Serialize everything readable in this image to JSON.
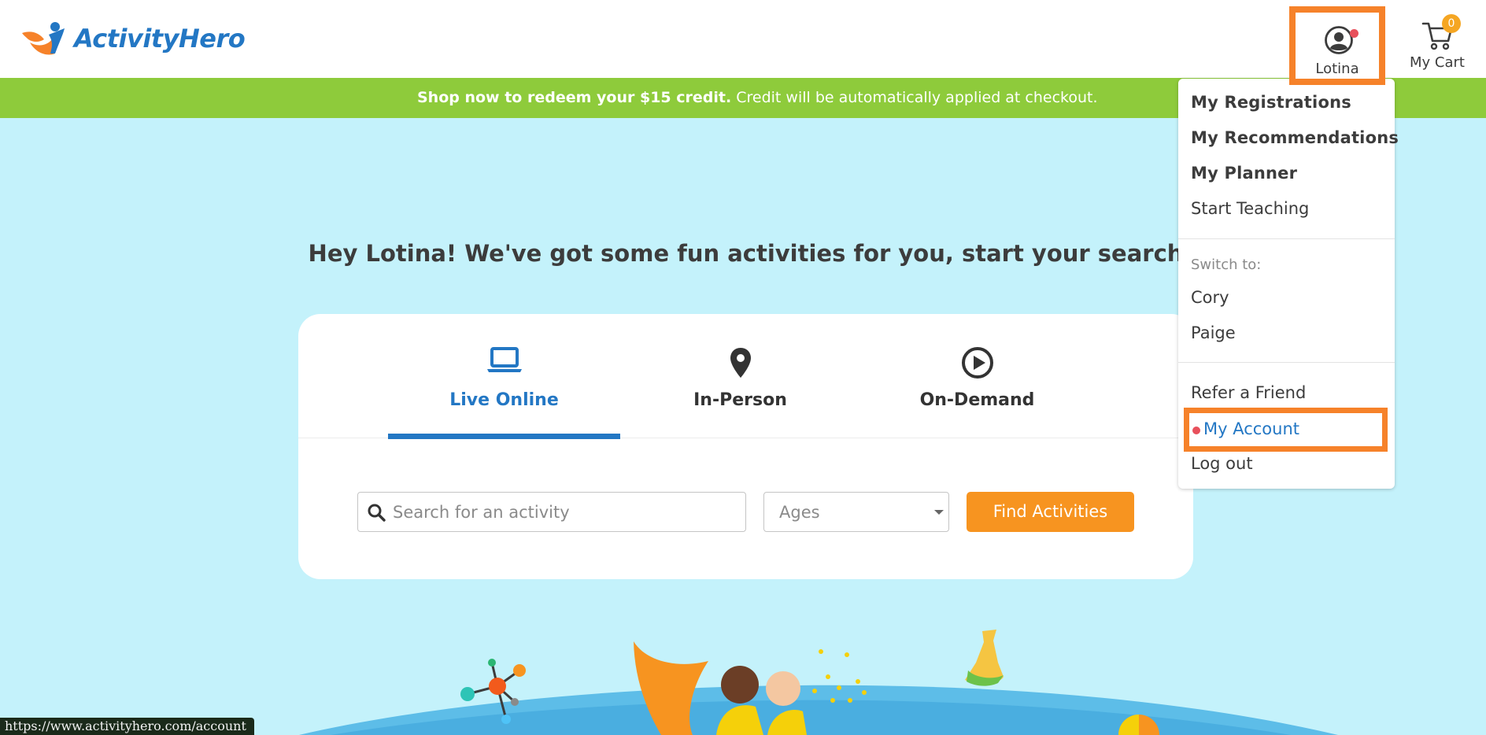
{
  "header": {
    "logo_text": "ActivityHero",
    "user_name": "Lotina",
    "cart_label": "My Cart",
    "cart_count": "0"
  },
  "banner": {
    "strong_text": "Shop now to redeem your $15 credit.",
    "text": " Credit will be automatically applied at checkout."
  },
  "hero": {
    "title": "Hey Lotina! We've got some fun activities for you, start your search"
  },
  "search": {
    "tabs": [
      {
        "label": "Live Online",
        "icon": "laptop-icon",
        "active": true
      },
      {
        "label": "In-Person",
        "icon": "map-pin-icon",
        "active": false
      },
      {
        "label": "On-Demand",
        "icon": "play-circle-icon",
        "active": false
      }
    ],
    "placeholder": "Search for an activity",
    "ages_value": "Ages",
    "find_label": "Find Activities"
  },
  "dropdown": {
    "items": [
      {
        "label": "My Registrations"
      },
      {
        "label": "My Recommendations"
      },
      {
        "label": "My Planner"
      },
      {
        "label": "Start Teaching"
      }
    ],
    "switch_label": "Switch to:",
    "switch_profiles": [
      {
        "label": "Cory"
      },
      {
        "label": "Paige"
      }
    ],
    "refer_label": "Refer a Friend",
    "account_label": "My Account",
    "logout_label": "Log out"
  },
  "status_bar": {
    "url": "https://www.activityhero.com/account"
  },
  "colors": {
    "brand_blue": "#2377c4",
    "brand_orange": "#f79420",
    "banner_green": "#8ecb3b",
    "hero_bg": "#c4f2fb",
    "highlight_orange": "#f6822a",
    "notify_red": "#e8505b"
  }
}
